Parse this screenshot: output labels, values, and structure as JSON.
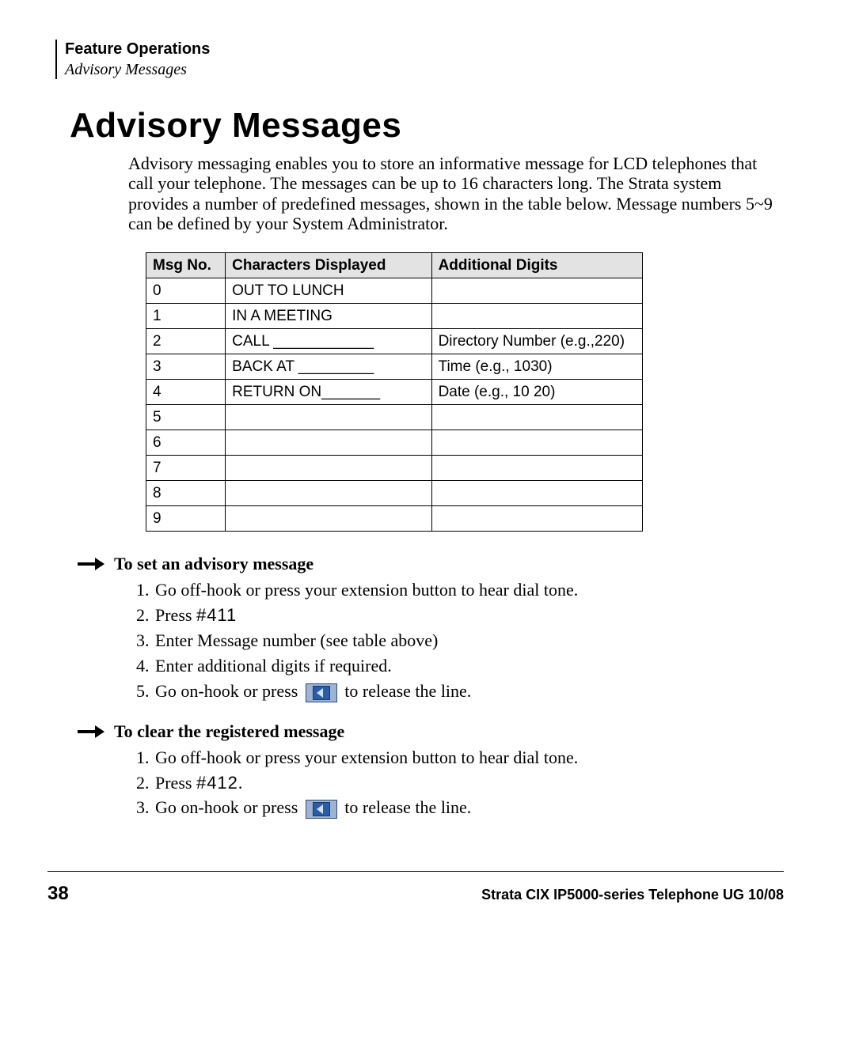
{
  "header": {
    "section": "Feature Operations",
    "subsection": "Advisory Messages"
  },
  "title": "Advisory Messages",
  "intro": "Advisory messaging enables you to store an informative message for LCD telephones that call your telephone. The messages can be up to 16 characters long. The Strata system provides a number of predefined messages, shown in the table below. Message numbers 5~9 can be defined by your System Administrator.",
  "table": {
    "headers": {
      "c1": "Msg No.",
      "c2": "Characters Displayed",
      "c3": "Additional Digits"
    },
    "rows": [
      {
        "no": "0",
        "chars": "OUT TO LUNCH",
        "add": ""
      },
      {
        "no": "1",
        "chars": "IN A MEETING",
        "add": ""
      },
      {
        "no": "2",
        "chars": "CALL ____________",
        "add": "Directory Number (e.g.,220)"
      },
      {
        "no": "3",
        "chars": "BACK AT _________",
        "add": "Time (e.g., 1030)"
      },
      {
        "no": "4",
        "chars": "RETURN ON_______",
        "add": "Date (e.g., 10 20)"
      },
      {
        "no": "5",
        "chars": "",
        "add": ""
      },
      {
        "no": "6",
        "chars": "",
        "add": ""
      },
      {
        "no": "7",
        "chars": "",
        "add": ""
      },
      {
        "no": "8",
        "chars": "",
        "add": ""
      },
      {
        "no": "9",
        "chars": "",
        "add": ""
      }
    ]
  },
  "set": {
    "heading": "To set an advisory message",
    "steps": {
      "s1": "Go off-hook or press your extension button to hear dial tone.",
      "s2a": "Press ",
      "s2b": "#411",
      "s3": "Enter Message number (see table above)",
      "s4": "Enter additional digits if required.",
      "s5a": "Go on-hook or press ",
      "s5b": " to release the line."
    }
  },
  "clear": {
    "heading": "To clear the registered message",
    "steps": {
      "s1": "Go off-hook or press your extension button to hear dial tone.",
      "s2a": "Press ",
      "s2b": "#412",
      "s2c": ".",
      "s3a": "Go on-hook or press ",
      "s3b": " to release the line."
    }
  },
  "footer": {
    "page": "38",
    "doc": "Strata CIX IP5000-series Telephone UG    10/08"
  }
}
